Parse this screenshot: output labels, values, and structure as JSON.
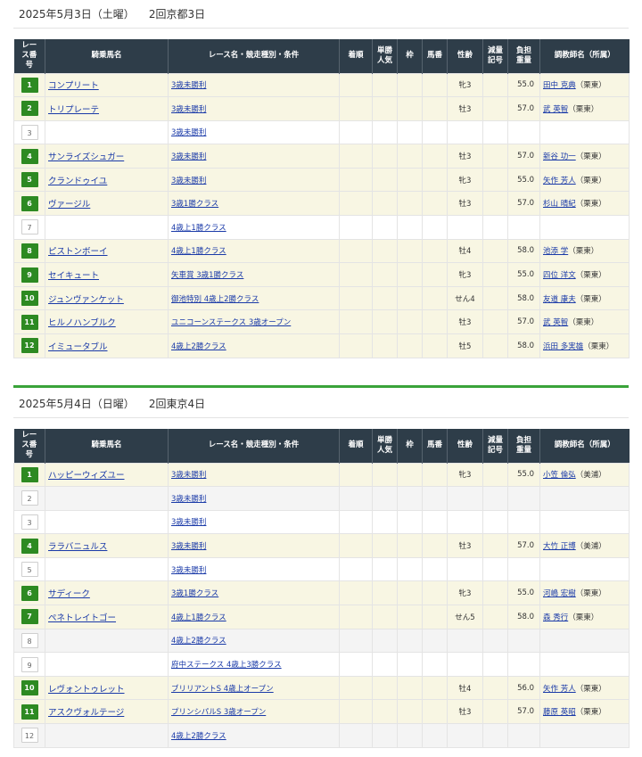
{
  "header": {
    "num": "レース番号",
    "horse": "騎乗馬名",
    "race": "レース名・競走種別・条件",
    "rank": "着順",
    "fav": "単勝人気",
    "frame": "枠",
    "horse_no": "馬番",
    "sex_age": "性齢",
    "reduce": "減量記号",
    "weight": "負担重量",
    "trainer": "調教師名（所属）"
  },
  "days": [
    {
      "date": "2025年5月3日（土曜）",
      "venue": "2回京都3日",
      "races": [
        {
          "no": "1",
          "horse": "コンプリート",
          "race": "3歳未勝利",
          "sex_age": "牝3",
          "weight": "55.0",
          "trainer": "田中 克典",
          "aff": "（栗東）"
        },
        {
          "no": "2",
          "horse": "トリプレーテ",
          "race": "3歳未勝利",
          "sex_age": "牡3",
          "weight": "57.0",
          "trainer": "武 英智",
          "aff": "（栗東）"
        },
        {
          "no": "3",
          "horse": "",
          "race": "3歳未勝利",
          "sex_age": "",
          "weight": "",
          "trainer": "",
          "aff": ""
        },
        {
          "no": "4",
          "horse": "サンライズシュガー",
          "race": "3歳未勝利",
          "sex_age": "牡3",
          "weight": "57.0",
          "trainer": "新谷 功一",
          "aff": "（栗東）"
        },
        {
          "no": "5",
          "horse": "クランドゥイユ",
          "race": "3歳未勝利",
          "sex_age": "牝3",
          "weight": "55.0",
          "trainer": "矢作 芳人",
          "aff": "（栗東）"
        },
        {
          "no": "6",
          "horse": "ヴァージル",
          "race": "3歳1勝クラス",
          "sex_age": "牡3",
          "weight": "57.0",
          "trainer": "杉山 晴紀",
          "aff": "（栗東）"
        },
        {
          "no": "7",
          "horse": "",
          "race": "4歳上1勝クラス",
          "sex_age": "",
          "weight": "",
          "trainer": "",
          "aff": ""
        },
        {
          "no": "8",
          "horse": "ピストンボーイ",
          "race": "4歳上1勝クラス",
          "sex_age": "牡4",
          "weight": "58.0",
          "trainer": "池添 学",
          "aff": "（栗東）"
        },
        {
          "no": "9",
          "horse": "セイキュート",
          "race": "矢車賞 3歳1勝クラス",
          "sex_age": "牝3",
          "weight": "55.0",
          "trainer": "四位 洋文",
          "aff": "（栗東）"
        },
        {
          "no": "10",
          "horse": "ジュンヴァンケット",
          "race": "御池特別 4歳上2勝クラス",
          "sex_age": "せん4",
          "weight": "58.0",
          "trainer": "友道 康夫",
          "aff": "（栗東）"
        },
        {
          "no": "11",
          "horse": "ヒルノハンブルク",
          "race": "ユニコーンステークス 3歳オープン",
          "sex_age": "牡3",
          "weight": "57.0",
          "trainer": "武 英智",
          "aff": "（栗東）"
        },
        {
          "no": "12",
          "horse": "イミュータブル",
          "race": "4歳上2勝クラス",
          "sex_age": "牡5",
          "weight": "58.0",
          "trainer": "浜田 多実雄",
          "aff": "（栗東）"
        }
      ]
    },
    {
      "date": "2025年5月4日（日曜）",
      "venue": "2回東京4日",
      "races": [
        {
          "no": "1",
          "horse": "ハッピーウィズユー",
          "race": "3歳未勝利",
          "sex_age": "牝3",
          "weight": "55.0",
          "trainer": "小笠 倫弘",
          "aff": "（美浦）"
        },
        {
          "no": "2",
          "horse": "",
          "race": "3歳未勝利",
          "sex_age": "",
          "weight": "",
          "trainer": "",
          "aff": ""
        },
        {
          "no": "3",
          "horse": "",
          "race": "3歳未勝利",
          "sex_age": "",
          "weight": "",
          "trainer": "",
          "aff": ""
        },
        {
          "no": "4",
          "horse": "ララバニュルス",
          "race": "3歳未勝利",
          "sex_age": "牡3",
          "weight": "57.0",
          "trainer": "大竹 正博",
          "aff": "（美浦）"
        },
        {
          "no": "5",
          "horse": "",
          "race": "3歳未勝利",
          "sex_age": "",
          "weight": "",
          "trainer": "",
          "aff": ""
        },
        {
          "no": "6",
          "horse": "サディーク",
          "race": "3歳1勝クラス",
          "sex_age": "牝3",
          "weight": "55.0",
          "trainer": "河嶋 宏樹",
          "aff": "（栗東）"
        },
        {
          "no": "7",
          "horse": "ペネトレイトゴー",
          "race": "4歳上1勝クラス",
          "sex_age": "せん5",
          "weight": "58.0",
          "trainer": "森 秀行",
          "aff": "（栗東）"
        },
        {
          "no": "8",
          "horse": "",
          "race": "4歳上2勝クラス",
          "sex_age": "",
          "weight": "",
          "trainer": "",
          "aff": ""
        },
        {
          "no": "9",
          "horse": "",
          "race": "府中ステークス 4歳上3勝クラス",
          "sex_age": "",
          "weight": "",
          "trainer": "",
          "aff": ""
        },
        {
          "no": "10",
          "horse": "レヴォントゥレット",
          "race": "ブリリアントS 4歳上オープン",
          "sex_age": "牡4",
          "weight": "56.0",
          "trainer": "矢作 芳人",
          "aff": "（栗東）"
        },
        {
          "no": "11",
          "horse": "アスクヴォルテージ",
          "race": "プリンシパルS 3歳オープン",
          "sex_age": "牡3",
          "weight": "57.0",
          "trainer": "藤原 英昭",
          "aff": "（栗東）"
        },
        {
          "no": "12",
          "horse": "",
          "race": "4歳上2勝クラス",
          "sex_age": "",
          "weight": "",
          "trainer": "",
          "aff": ""
        }
      ]
    }
  ],
  "colors": {
    "header_bg": "#2e3d49",
    "badge_green": "#2d8a22",
    "row_horse": "#f8f6e3",
    "divider_green": "#3aa33a",
    "link": "#1a3aa8"
  }
}
